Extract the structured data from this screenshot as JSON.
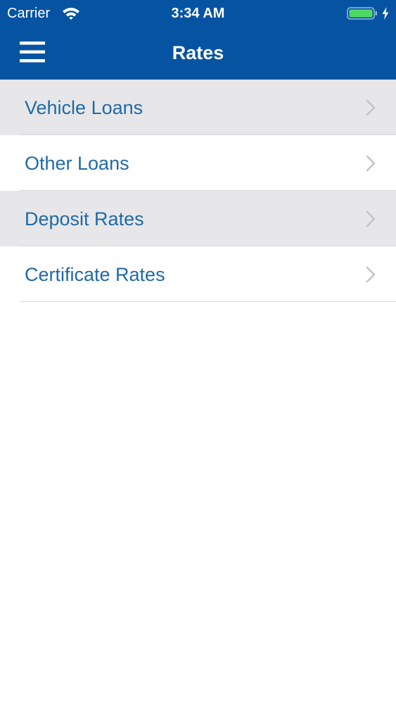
{
  "status_bar": {
    "carrier": "Carrier",
    "time": "3:34 AM",
    "icons": [
      "wifi-icon",
      "battery-icon",
      "charging-bolt-icon"
    ],
    "battery_color": "#4cd964"
  },
  "nav": {
    "title": "Rates",
    "menu_icon": "hamburger-menu-icon",
    "bar_color": "#0654a1"
  },
  "rates": {
    "items": [
      {
        "label": "Vehicle Loans"
      },
      {
        "label": "Other Loans"
      },
      {
        "label": "Deposit Rates"
      },
      {
        "label": "Certificate Rates"
      }
    ],
    "row_icon": "chevron-right-icon",
    "label_color": "#1f6aa5",
    "shaded_row_color": "#e7e7e9"
  }
}
